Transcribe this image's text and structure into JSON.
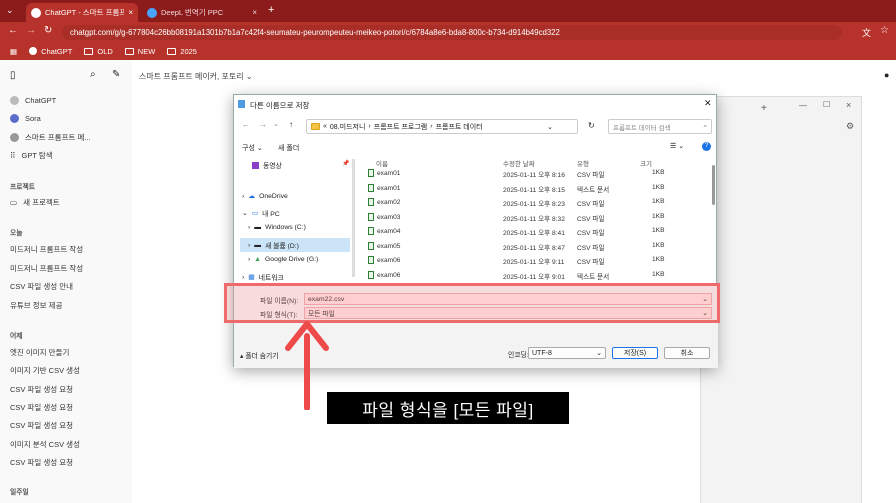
{
  "browser": {
    "tabs": [
      {
        "label": "ChatGPT - 스마트 프롬프트 메"
      },
      {
        "label": "DeepL 번역기 PPC"
      }
    ],
    "url": "chatgpt.com/g/g-677804c26bb08191a1301b7b1a7c42f4-seumateu-peurompeuteu-meikeo-potori/c/6784a8e6-bda8-800c-b734-d914b49cd322",
    "bookmarks": [
      "ChatGPT",
      "OLD",
      "NEW",
      "2025"
    ]
  },
  "chatgpt": {
    "title": "스마트 프롬프트 메이커, 포토리",
    "nav": [
      "ChatGPT",
      "Sora",
      "스마트 프롬프트 메...",
      "GPT 탐색"
    ],
    "projects_header": "프로젝트",
    "new_project": "새 프로젝트",
    "today_header": "오늘",
    "today_items": [
      "미드저니 프롬프트 작성",
      "미드저니 프롬프트 작성",
      "CSV 파일 생성 안내",
      "유튜브 정보 제공"
    ],
    "yesterday_header": "어제",
    "yesterday_items": [
      "엣진 이미지 만들기",
      "이미지 기반 CSV 생성",
      "CSV 파일 생성 요청",
      "CSV 파일 생성 요청",
      "CSV 파일 생성 요청",
      "이미지 분석 CSV 생성",
      "CSV 파일 생성 요청"
    ],
    "bottom_label": "일주일"
  },
  "dialog": {
    "title": "다른 이름으로 저장",
    "breadcrumb": [
      "08.미드저니",
      "프롬프트 프로그램",
      "프롬프트 데이터"
    ],
    "search_placeholder": "프롬프트 데이터 검색",
    "organize": "구성",
    "new_folder": "새 폴더",
    "nav_items": [
      "동영상",
      "OneDrive",
      "내 PC",
      "Windows (C:)",
      "새 볼륨 (D:)",
      "Google Drive (G:)",
      "네트워크"
    ],
    "columns": [
      "이름",
      "수정한 날짜",
      "유형",
      "크기"
    ],
    "files": [
      {
        "name": "exam01",
        "date": "2025-01-11 오후 8:16",
        "type": "CSV 파일",
        "size": "1KB"
      },
      {
        "name": "exam01",
        "date": "2025-01-11 오후 8:15",
        "type": "텍스트 문서",
        "size": "1KB"
      },
      {
        "name": "exam02",
        "date": "2025-01-11 오후 8:23",
        "type": "CSV 파일",
        "size": "1KB"
      },
      {
        "name": "exam03",
        "date": "2025-01-11 오후 8:32",
        "type": "CSV 파일",
        "size": "1KB"
      },
      {
        "name": "exam04",
        "date": "2025-01-11 오후 8:41",
        "type": "CSV 파일",
        "size": "1KB"
      },
      {
        "name": "exam05",
        "date": "2025-01-11 오후 8:47",
        "type": "CSV 파일",
        "size": "1KB"
      },
      {
        "name": "exam06",
        "date": "2025-01-11 오후 9:11",
        "type": "CSV 파일",
        "size": "1KB"
      },
      {
        "name": "exam06",
        "date": "2025-01-11 오후 9:01",
        "type": "텍스트 문서",
        "size": "1KB"
      }
    ],
    "filename_label": "파일 이름(N):",
    "filename_value": "exam22.csv",
    "filetype_label": "파일 형식(T):",
    "filetype_value": "모든 파일",
    "hide_folders": "폴더 숨기기",
    "encoding_label": "인코딩:",
    "encoding_value": "UTF-8",
    "save": "저장(S)",
    "cancel": "취소"
  },
  "caption": "파일 형식을 [모든 파일]",
  "colors": {
    "browser": "#b7322b",
    "highlight": "#ef6a6a",
    "arrow": "#ef4a4a"
  }
}
